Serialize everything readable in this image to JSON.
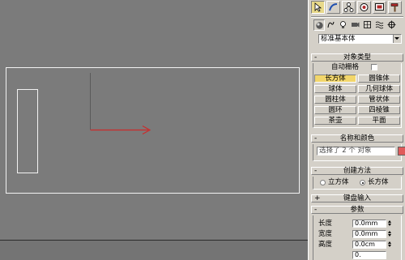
{
  "command_panel": {
    "tabs": [
      {
        "name": "create",
        "icon": "pointer-icon"
      },
      {
        "name": "modify",
        "icon": "arc-icon"
      },
      {
        "name": "hierarchy",
        "icon": "hierarchy-icon"
      },
      {
        "name": "motion",
        "icon": "motion-icon"
      },
      {
        "name": "display",
        "icon": "display-icon"
      },
      {
        "name": "utilities",
        "icon": "hammer-icon"
      }
    ],
    "categories": [
      {
        "name": "geometry",
        "icon": "sphere-icon"
      },
      {
        "name": "shapes",
        "icon": "shapes-icon"
      },
      {
        "name": "lights",
        "icon": "light-icon"
      },
      {
        "name": "cameras",
        "icon": "camera-icon"
      },
      {
        "name": "helpers",
        "icon": "helper-icon"
      },
      {
        "name": "space-warps",
        "icon": "spacewarp-icon"
      },
      {
        "name": "systems",
        "icon": "systems-icon"
      }
    ],
    "subcategory_dropdown": "标准基本体",
    "object_type": {
      "header": "对象类型",
      "autogrid_label": "自动栅格",
      "buttons": [
        "长方体",
        "圆锥体",
        "球体",
        "几何球体",
        "圆柱体",
        "管状体",
        "圆环",
        "四棱锥",
        "茶壶",
        "平面"
      ],
      "active": "长方体"
    },
    "name_color": {
      "header": "名称和颜色",
      "name_value": "选择了 2 个 对象"
    },
    "creation_method": {
      "header": "创建方法",
      "options": [
        "立方体",
        "长方体"
      ],
      "selected": "长方体"
    },
    "keyboard_entry": {
      "header": "键盘输入"
    },
    "parameters": {
      "header": "参数",
      "rows": [
        {
          "label": "长度",
          "value": "0.0mm"
        },
        {
          "label": "宽度",
          "value": "0.0mm"
        },
        {
          "label": "高度",
          "value": "0.0cm"
        },
        {
          "label": "",
          "value": "0."
        }
      ]
    },
    "colors": {
      "panel_bg": "#d4d0c8",
      "active_button": "#f2d66b",
      "object_color": "#e05a5a"
    }
  },
  "viewport": {
    "background": "#7b7b7b",
    "axis_color": "#cc2a2a"
  }
}
